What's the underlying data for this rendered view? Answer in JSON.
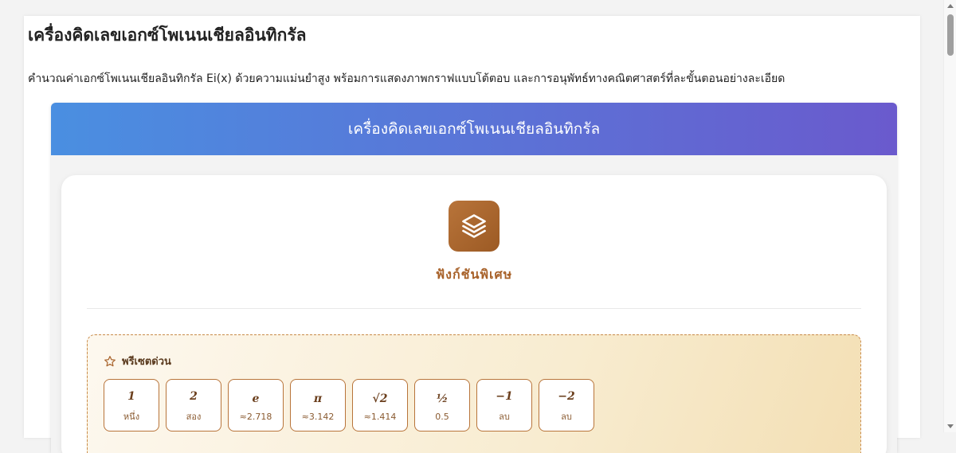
{
  "page": {
    "title": "เครื่องคิดเลขเอกซ์โพเนนเชียลอินทิกรัล",
    "description": "คำนวณค่าเอกซ์โพเนนเชียลอินทิกรัล Ei(x) ด้วยความแม่นยำสูง พร้อมการแสดงภาพกราฟแบบโต้ตอบ และการอนุพัทธ์ทางคณิตศาสตร์ที่ละขั้นตอนอย่างละเอียด"
  },
  "calculator": {
    "header": "เครื่องคิดเลขเอกซ์โพเนนเชียลอินทิกรัล",
    "category_icon": "layers-icon",
    "category_title": "ฟังก์ชันพิเศษ",
    "presets": {
      "heading": "พรีเซตด่วน",
      "heading_icon": "star-icon",
      "items": [
        {
          "symbol": "1",
          "desc": "หนึ่ง"
        },
        {
          "symbol": "2",
          "desc": "สอง"
        },
        {
          "symbol": "e",
          "desc": "≈2.718"
        },
        {
          "symbol": "π",
          "desc": "≈3.142"
        },
        {
          "symbol": "√2",
          "desc": "≈1.414"
        },
        {
          "symbol": "½",
          "desc": "0.5"
        },
        {
          "symbol": "−1",
          "desc": "ลบ"
        },
        {
          "symbol": "−2",
          "desc": "ลบ"
        }
      ]
    }
  },
  "colors": {
    "header_gradient_start": "#4a8fe1",
    "header_gradient_end": "#6a5acd",
    "accent_brown": "#a8622a",
    "preset_border": "#b8743a"
  }
}
